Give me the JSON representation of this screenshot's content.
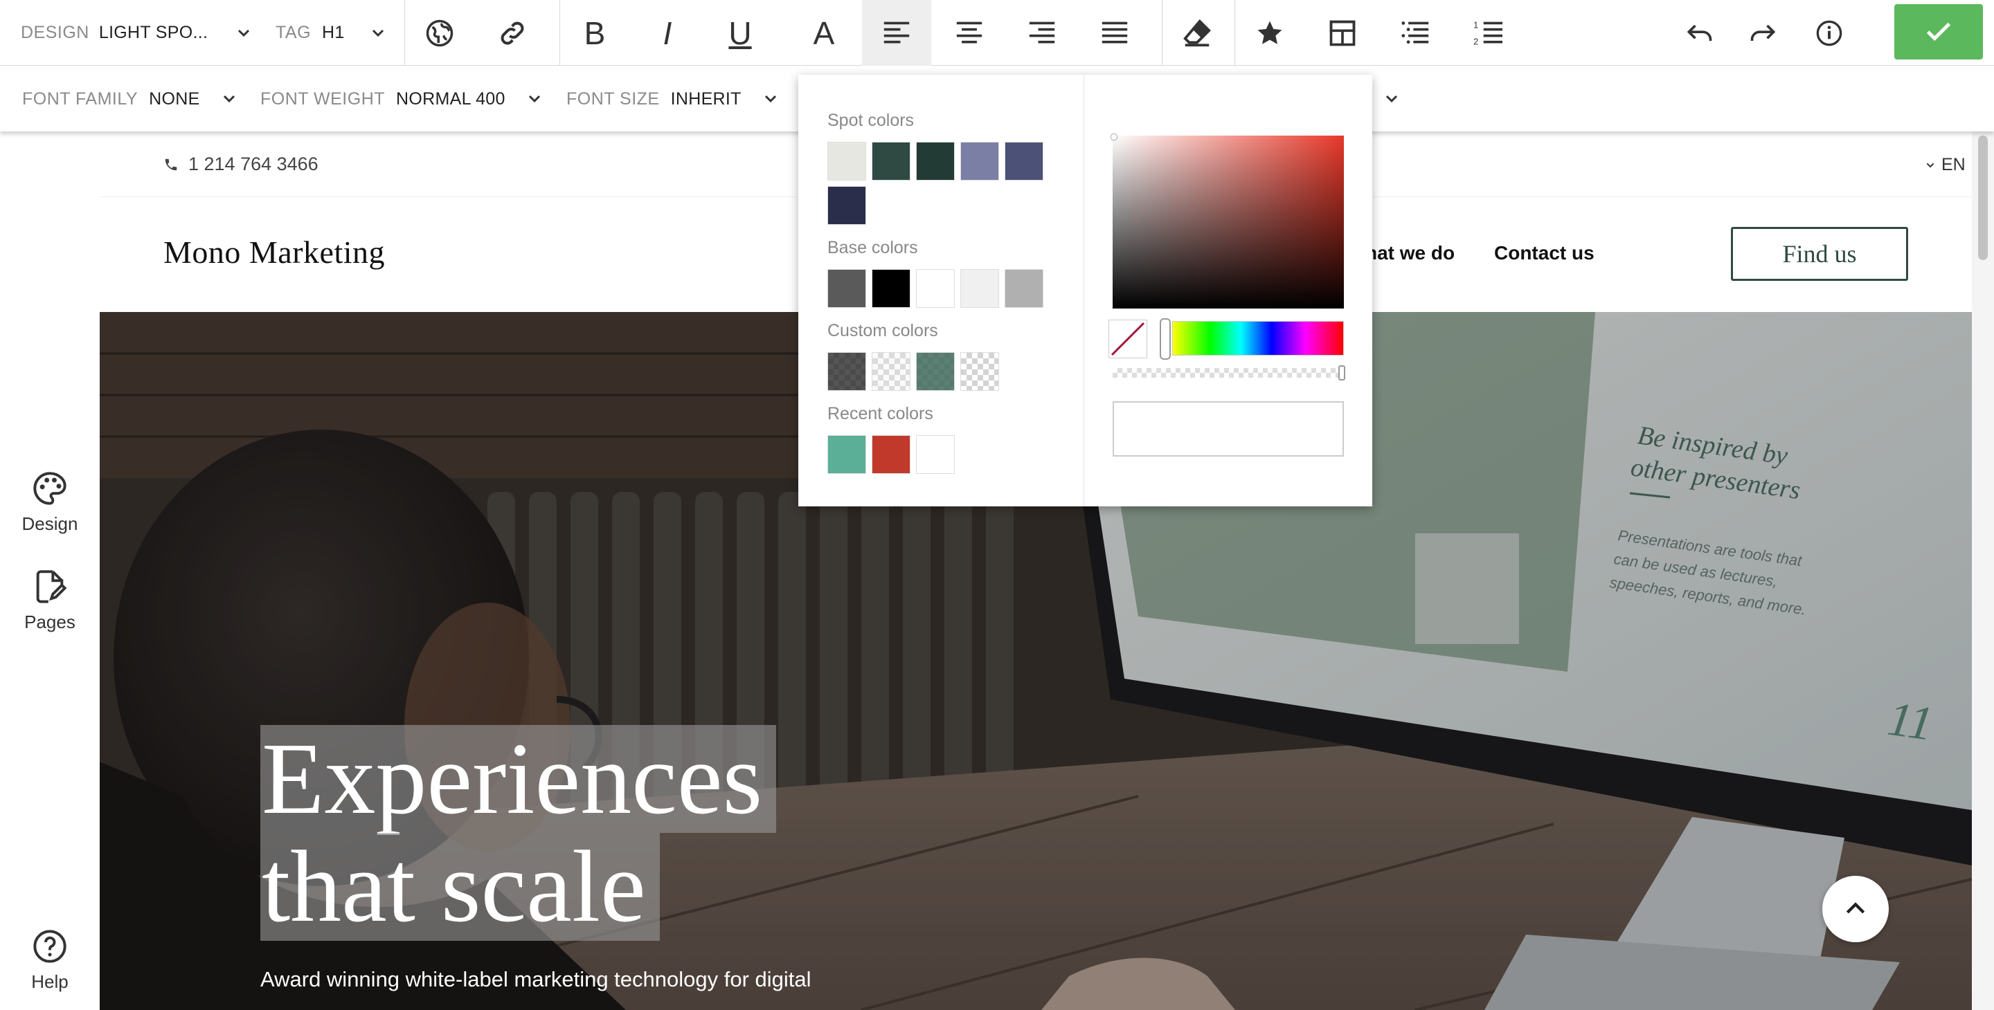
{
  "toolbar": {
    "design_label": "DESIGN",
    "design_value": "LIGHT SPO...",
    "tag_label": "TAG",
    "tag_value": "H1",
    "bold_glyph": "B",
    "italic_glyph": "I",
    "underline_glyph": "U",
    "color_glyph": "A"
  },
  "toolbar2": {
    "font_family_label": "FONT FAMILY",
    "font_family_value": "NONE",
    "font_weight_label": "FONT WEIGHT",
    "font_weight_value": "NORMAL 400",
    "font_size_label": "FONT SIZE",
    "font_size_value": "INHERIT"
  },
  "sidebar": {
    "items": [
      {
        "label": "Design",
        "icon": "palette-icon"
      },
      {
        "label": "Pages",
        "icon": "page-edit-icon"
      },
      {
        "label": "Help",
        "icon": "help-icon"
      }
    ]
  },
  "site": {
    "phone": "1 214 764 3466",
    "language": "EN",
    "brand": "Mono Marketing",
    "nav": [
      "hat we do",
      "Contact us"
    ],
    "cta": "Find us",
    "hero_line1": "Experiences",
    "hero_line2": "that scale",
    "hero_subtitle": "Award winning white-label marketing technology for digital",
    "screen_heading": "Be inspired by other presenters",
    "screen_body": "Presentations are tools that can be used as lectures, speeches, reports, and more.",
    "screen_number": "11"
  },
  "picker": {
    "spot_title": "Spot colors",
    "spot_colors": [
      "#e7e7e2",
      "#2e4a43",
      "#233b35",
      "#7b7fa6",
      "#4c5178",
      "#2b2e4a"
    ],
    "base_title": "Base colors",
    "base_colors": [
      "#5a5a5a",
      "#000000",
      "#ffffff",
      "#f0f0f0",
      "#b0b0b0"
    ],
    "custom_title": "Custom colors",
    "custom_colors": [
      "#2a2a2a",
      "#f2f2f2",
      "#3f6a5c",
      "#ffffff"
    ],
    "recent_title": "Recent colors",
    "recent_colors": [
      "#5aaf96",
      "#c0392b",
      "#ffffff"
    ],
    "hue_color": "#e8392a",
    "hex_value": ""
  },
  "colors": {
    "accent_green": "#5cb85c",
    "brand_dark": "#2f4a42"
  }
}
